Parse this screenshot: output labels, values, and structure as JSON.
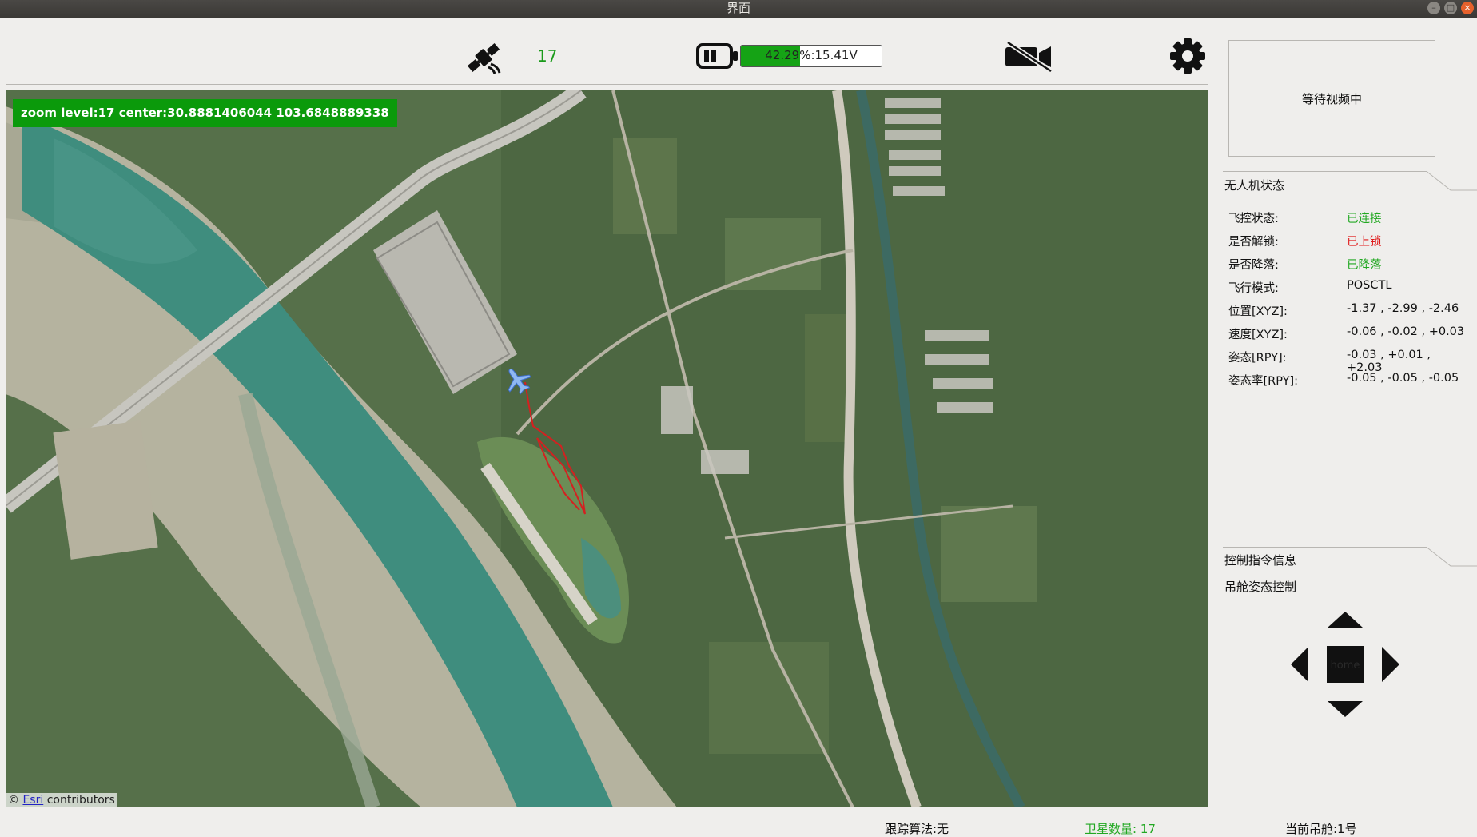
{
  "window": {
    "title": "界面"
  },
  "toolbar": {
    "satellite_count": "17",
    "battery": {
      "level_percent": 42.29,
      "text": "42.29%:15.41V"
    }
  },
  "map": {
    "zoom_label": "zoom level:17 center:30.8881406044 103.6848889338",
    "attribution_prefix": "©",
    "attribution_link": "Esri",
    "attribution_suffix": "contributors"
  },
  "video": {
    "placeholder": "等待视频中"
  },
  "uav_status": {
    "title": "无人机状态",
    "rows": [
      {
        "label": "飞控状态:",
        "value": "已连接"
      },
      {
        "label": "是否解锁:",
        "value": "已上锁"
      },
      {
        "label": "是否降落:",
        "value": "已降落"
      },
      {
        "label": "飞行模式:",
        "value": "POSCTL"
      },
      {
        "label": "位置[XYZ]:",
        "value": "-1.37 , -2.99 , -2.46"
      },
      {
        "label": "速度[XYZ]:",
        "value": "-0.06 , -0.02 , +0.03"
      },
      {
        "label": "姿态[RPY]:",
        "value": "-0.03 , +0.01 , +2.03"
      },
      {
        "label": "姿态率[RPY]:",
        "value": "-0.05 , -0.05 , -0.05"
      }
    ]
  },
  "control": {
    "title": "控制指令信息",
    "subtitle": "吊舱姿态控制",
    "home_label": "home"
  },
  "footer": {
    "tracking": "跟踪算法:无",
    "satellites": "卫星数量: 17",
    "pod": "当前吊舱:1号"
  },
  "colors": {
    "ok_green": "#22a822",
    "alert_red": "#e01818",
    "zoom_label_bg": "#0b9a0b",
    "battery_fill": "#15a315",
    "track_red": "#d42020"
  },
  "icons": [
    "satellite-icon",
    "battery-icon",
    "camera-off-icon",
    "gear-icon",
    "aircraft-icon"
  ]
}
